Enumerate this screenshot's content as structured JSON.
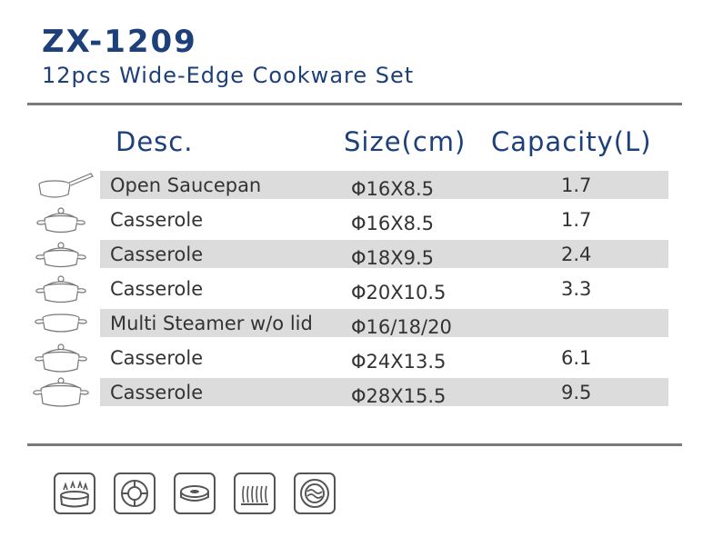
{
  "header": {
    "model": "ZX-1209",
    "subtitle": "12pcs Wide-Edge Cookware Set"
  },
  "table": {
    "columns": [
      "Desc.",
      "Size(cm)",
      "Capacity(L)"
    ],
    "rows": [
      {
        "desc": "Open Saucepan",
        "size": "Φ16X8.5",
        "capacity": "1.7",
        "icon": "saucepan-icon"
      },
      {
        "desc": "Casserole",
        "size": "Φ16X8.5",
        "capacity": "1.7",
        "icon": "casserole-icon"
      },
      {
        "desc": "Casserole",
        "size": "Φ18X9.5",
        "capacity": "2.4",
        "icon": "casserole-icon"
      },
      {
        "desc": "Casserole",
        "size": "Φ20X10.5",
        "capacity": "3.3",
        "icon": "casserole-icon"
      },
      {
        "desc": "Multi Steamer w/o lid",
        "size": "Φ16/18/20",
        "capacity": "",
        "icon": "steamer-icon"
      },
      {
        "desc": "Casserole",
        "size": "Φ24X13.5",
        "capacity": "6.1",
        "icon": "casserole-icon"
      },
      {
        "desc": "Casserole",
        "size": "Φ28X15.5",
        "capacity": "9.5",
        "icon": "casserole-icon"
      }
    ]
  },
  "compatibility_icons": [
    "gas-stove-icon",
    "electric-hob-icon",
    "ceramic-hob-icon",
    "halogen-hob-icon",
    "induction-icon"
  ],
  "colors": {
    "title": "#1d3f7a",
    "band": "#dcdcdc",
    "rule": "#7a7a7a"
  }
}
